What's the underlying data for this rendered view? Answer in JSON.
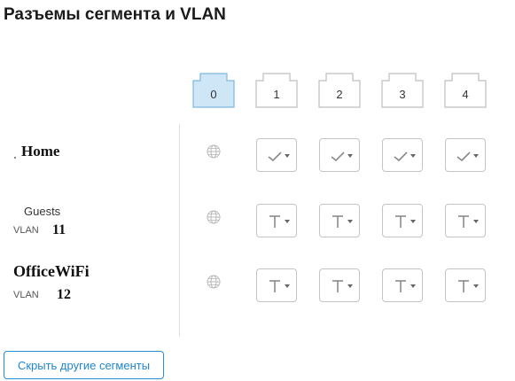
{
  "title": "Разъемы сегмента и VLAN",
  "ports": [
    {
      "label": "0",
      "active": true
    },
    {
      "label": "1",
      "active": false
    },
    {
      "label": "2",
      "active": false
    },
    {
      "label": "3",
      "active": false
    },
    {
      "label": "4",
      "active": false
    }
  ],
  "segments": [
    {
      "name": "Home",
      "vlan_label": "",
      "vlan": "",
      "cell_icon": "checkmark-icon"
    },
    {
      "name": "Guests",
      "vlan_label": "VLAN",
      "vlan": "11",
      "cell_icon": "tagged-icon"
    },
    {
      "name": "OfficeWiFi",
      "vlan_label": "VLAN",
      "vlan": "12",
      "cell_icon": "tagged-icon"
    }
  ],
  "button": {
    "label": "Скрыть другие сегменты"
  },
  "colors": {
    "accent": "#1f86cf",
    "port_active_fill": "#cfe6f6",
    "port_active_border": "#7fb8e0",
    "border": "#c4c4c4"
  }
}
